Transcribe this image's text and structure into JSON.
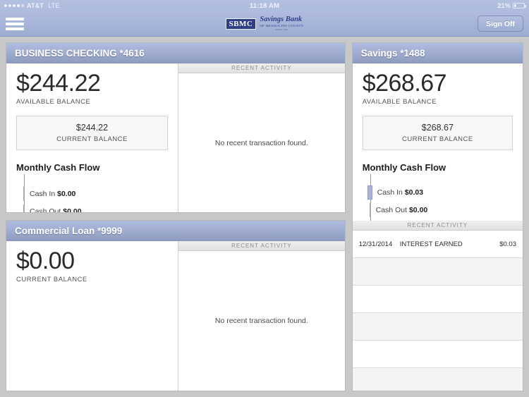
{
  "status_bar": {
    "signal_dots_filled": 4,
    "signal_dots_total": 5,
    "carrier": "AT&T",
    "network": "LTE",
    "time": "11:18 AM",
    "battery_percent": "21%"
  },
  "navbar": {
    "menu_icon": "hamburger-icon",
    "brand_mark": "SBMC",
    "brand_name": "Savings Bank",
    "brand_sub": "OF MENDOCINO COUNTY",
    "brand_sub2": "SINCE 1903",
    "sign_off_label": "Sign Off"
  },
  "labels": {
    "available_balance": "AVAILABLE BALANCE",
    "current_balance": "CURRENT BALANCE",
    "recent_activity": "RECENT ACTIVITY",
    "monthly_cash_flow": "Monthly Cash Flow",
    "cash_in": "Cash In",
    "cash_out": "Cash Out",
    "no_transactions": "No recent transaction found."
  },
  "colors": {
    "header_gradient_top": "#b0bde0",
    "header_gradient_bottom": "#8e9cc0",
    "brand_blue": "#2e3f86",
    "cash_bar_blue": "#aab4dd",
    "page_background": "#c8c8c8"
  },
  "accounts": {
    "business_checking": {
      "title": "BUSINESS CHECKING *4616",
      "available_balance": "$244.22",
      "current_balance": "$244.22",
      "cash_in": "$0.00",
      "cash_out": "$0.00",
      "activity_empty_text": "No recent transaction found."
    },
    "commercial_loan": {
      "title": "Commercial Loan *9999",
      "current_balance": "$0.00",
      "activity_empty_text": "No recent transaction found."
    },
    "savings": {
      "title": "Savings *1488",
      "available_balance": "$268.67",
      "current_balance": "$268.67",
      "cash_in": "$0.03",
      "cash_out": "$0.00",
      "transactions": [
        {
          "date": "12/31/2014",
          "description": "INTEREST EARNED",
          "amount": "$0.03"
        }
      ],
      "empty_row_count": 5
    }
  }
}
